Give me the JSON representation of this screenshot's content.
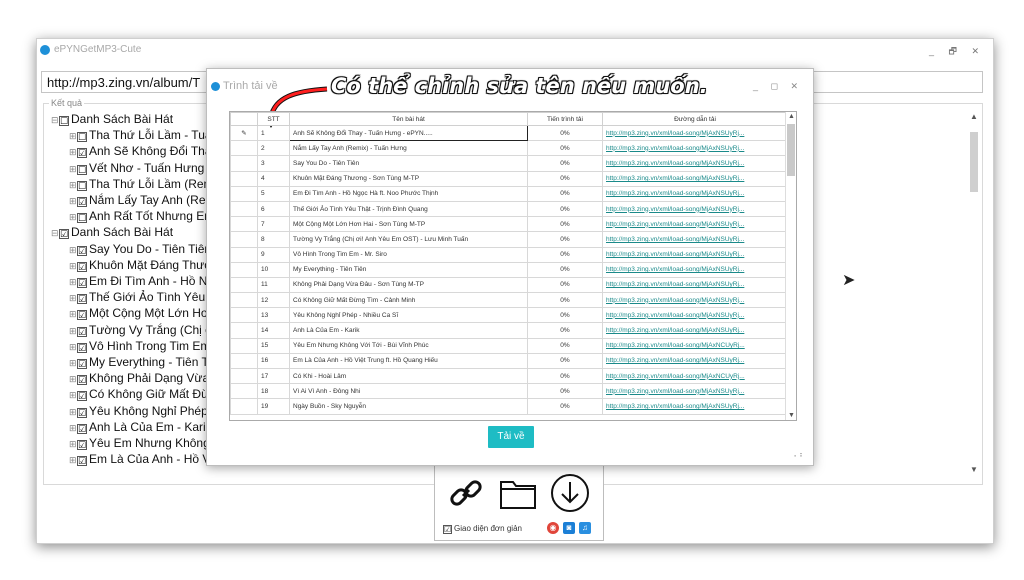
{
  "app": {
    "title": "ePYNGetMP3-Cute",
    "window_controls": "_ 🗗 ✕"
  },
  "url": "http://mp3.zing.vn/album/T",
  "results_label": "Kết quả",
  "tree": [
    {
      "level": 1,
      "pm": "⊟",
      "check": "☐",
      "text": "Danh Sách Bài Hát"
    },
    {
      "level": 2,
      "pm": "⊞",
      "check": "☐",
      "text": "Tha Thứ Lỗi Lầm - Tuấn"
    },
    {
      "level": 2,
      "pm": "⊞",
      "check": "☑",
      "text": "Anh Sẽ Không Đổi Thay"
    },
    {
      "level": 2,
      "pm": "⊞",
      "check": "☐",
      "text": "Vết Nhơ - Tuấn Hưng"
    },
    {
      "level": 2,
      "pm": "⊞",
      "check": "☐",
      "text": "Tha Thứ Lỗi Lầm (Remix"
    },
    {
      "level": 2,
      "pm": "⊞",
      "check": "☑",
      "text": "Nắm Lấy Tay Anh (Remi"
    },
    {
      "level": 2,
      "pm": "⊞",
      "check": "☐",
      "text": "Anh Rất Tốt Nhưng Em"
    },
    {
      "level": 1,
      "pm": "⊟",
      "check": "☑",
      "text": "Danh Sách Bài Hát"
    },
    {
      "level": 2,
      "pm": "⊞",
      "check": "☑",
      "text": "Say You Do - Tiên Tiên"
    },
    {
      "level": 2,
      "pm": "⊞",
      "check": "☑",
      "text": "Khuôn Mặt Đáng Thương"
    },
    {
      "level": 2,
      "pm": "⊞",
      "check": "☑",
      "text": "Em Đi Tìm Anh - Hồ Ngọ"
    },
    {
      "level": 2,
      "pm": "⊞",
      "check": "☑",
      "text": "Thế Giới Ảo Tình Yêu Th"
    },
    {
      "level": 2,
      "pm": "⊞",
      "check": "☑",
      "text": "Một Cộng Một Lớn Hơn H"
    },
    {
      "level": 2,
      "pm": "⊞",
      "check": "☑",
      "text": "Tường Vy Trắng (Chị ơi!"
    },
    {
      "level": 2,
      "pm": "⊞",
      "check": "☑",
      "text": "Vô Hình Trong Tim Em -"
    },
    {
      "level": 2,
      "pm": "⊞",
      "check": "☑",
      "text": "My Everything - Tiên Tiê"
    },
    {
      "level": 2,
      "pm": "⊞",
      "check": "☑",
      "text": "Không Phải Dạng Vừa Đả"
    },
    {
      "level": 2,
      "pm": "⊞",
      "check": "☑",
      "text": "Có Không Giữ Mất Đừng"
    },
    {
      "level": 2,
      "pm": "⊞",
      "check": "☑",
      "text": "Yêu Không Nghỉ Phép -"
    },
    {
      "level": 2,
      "pm": "⊞",
      "check": "☑",
      "text": "Anh Là Của Em - Karik"
    },
    {
      "level": 2,
      "pm": "⊞",
      "check": "☑",
      "text": "Yêu Em Nhưng Không V"
    },
    {
      "level": 2,
      "pm": "⊞",
      "check": "☑",
      "text": "Em Là Của Anh - Hồ Việ"
    }
  ],
  "bottom": {
    "simple_mode": "Giao diện đơn giản",
    "simple_checked": "☑"
  },
  "dialog": {
    "title": "Trình tải về",
    "controls": "_ ◻ ✕",
    "annotation": "Có thể chỉnh sửa tên nếu muốn.",
    "columns": {
      "stt": "STT",
      "name": "Tên bài hát",
      "progress": "Tiến trình tải",
      "path": "Đường dẫn tải"
    },
    "rows": [
      {
        "stt": "1",
        "name": "Anh Sẽ Không Đổi Thay - Tuấn Hưng - ePYN.....",
        "progress": "0%",
        "path": "http://mp3.zing.vn/xml/load-song/MjAxNSUyRj...",
        "edit": "✎"
      },
      {
        "stt": "2",
        "name": "Nắm Lấy Tay Anh (Remix) - Tuấn Hưng",
        "progress": "0%",
        "path": "http://mp3.zing.vn/xml/load-song/MjAxNSUyRj..."
      },
      {
        "stt": "3",
        "name": "Say You Do - Tiên Tiên",
        "progress": "0%",
        "path": "http://mp3.zing.vn/xml/load-song/MjAxNSUyRj..."
      },
      {
        "stt": "4",
        "name": "Khuôn Mặt Đáng Thương - Sơn Tùng M-TP",
        "progress": "0%",
        "path": "http://mp3.zing.vn/xml/load-song/MjAxNSUyRj..."
      },
      {
        "stt": "5",
        "name": "Em Đi Tìm Anh - Hồ Ngọc Hà  ft.  Noo Phước Thịnh",
        "progress": "0%",
        "path": "http://mp3.zing.vn/xml/load-song/MjAxNSUyRj..."
      },
      {
        "stt": "6",
        "name": "Thế Giới Ảo Tình Yêu Thật - Trịnh Đình Quang",
        "progress": "0%",
        "path": "http://mp3.zing.vn/xml/load-song/MjAxNSUyRj..."
      },
      {
        "stt": "7",
        "name": "Một Cộng Một Lớn Hơn Hai - Sơn Tùng M-TP",
        "progress": "0%",
        "path": "http://mp3.zing.vn/xml/load-song/MjAxNSUyRj..."
      },
      {
        "stt": "8",
        "name": "Tường Vy Trắng (Chị ơi! Anh Yêu Em OST) - Lưu Minh Tuấn",
        "progress": "0%",
        "path": "http://mp3.zing.vn/xml/load-song/MjAxNSUyRj..."
      },
      {
        "stt": "9",
        "name": "Vô Hình Trong Tim Em - Mr. Siro",
        "progress": "0%",
        "path": "http://mp3.zing.vn/xml/load-song/MjAxNSUyRj..."
      },
      {
        "stt": "10",
        "name": "My Everything - Tiên Tiên",
        "progress": "0%",
        "path": "http://mp3.zing.vn/xml/load-song/MjAxNSUyRj..."
      },
      {
        "stt": "11",
        "name": "Không Phải Dạng Vừa Đâu - Sơn Tùng M-TP",
        "progress": "0%",
        "path": "http://mp3.zing.vn/xml/load-song/MjAxNSUyRj..."
      },
      {
        "stt": "12",
        "name": "Có Không Giữ Mất Đừng Tìm - Cảnh Minh",
        "progress": "0%",
        "path": "http://mp3.zing.vn/xml/load-song/MjAxNSUyRj..."
      },
      {
        "stt": "13",
        "name": "Yêu Không Nghỉ Phép - Nhiều Ca Sĩ",
        "progress": "0%",
        "path": "http://mp3.zing.vn/xml/load-song/MjAxNSUyRj..."
      },
      {
        "stt": "14",
        "name": "Anh Là Của Em - Karik",
        "progress": "0%",
        "path": "http://mp3.zing.vn/xml/load-song/MjAxNSUyRj..."
      },
      {
        "stt": "15",
        "name": "Yêu Em Nhưng Không Với Tới - Bùi Vĩnh Phúc",
        "progress": "0%",
        "path": "http://mp3.zing.vn/xml/load-song/MjAxNCUyRj..."
      },
      {
        "stt": "16",
        "name": "Em Là Của Anh - Hồ Việt Trung  ft.  Hồ Quang Hiếu",
        "progress": "0%",
        "path": "http://mp3.zing.vn/xml/load-song/MjAxNSUyRj..."
      },
      {
        "stt": "17",
        "name": "Có Khi - Hoài Lâm",
        "progress": "0%",
        "path": "http://mp3.zing.vn/xml/load-song/MjAxNCUyRj..."
      },
      {
        "stt": "18",
        "name": "Vì Ai Vì Anh - Đông Nhi",
        "progress": "0%",
        "path": "http://mp3.zing.vn/xml/load-song/MjAxNSUyRj..."
      },
      {
        "stt": "19",
        "name": "Ngày Buồn - Sky Nguyễn",
        "progress": "0%",
        "path": "http://mp3.zing.vn/xml/load-song/MjAxNSUyRj..."
      }
    ],
    "download_label": "Tải về"
  },
  "colors": {
    "accent": "#1ebcc4",
    "link": "#1a8a8a",
    "app_icon": "#1e90d8"
  }
}
